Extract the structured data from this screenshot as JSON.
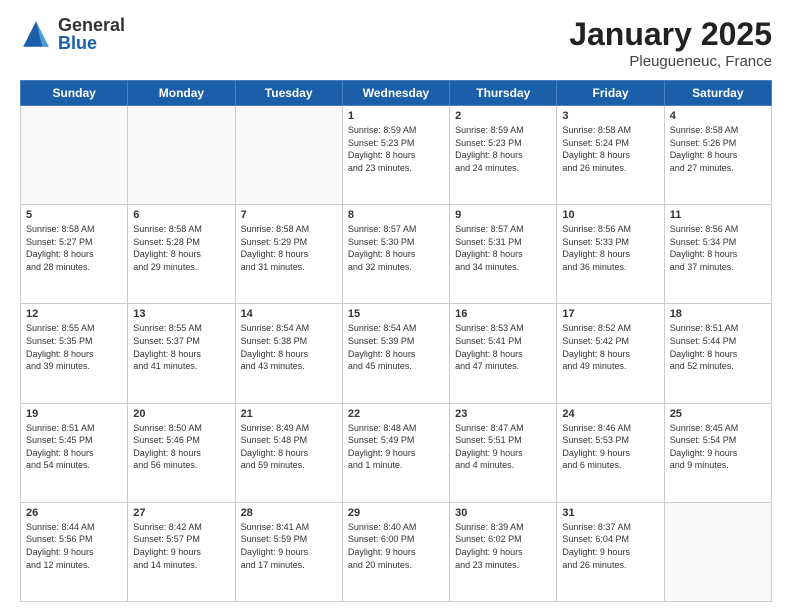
{
  "header": {
    "logo_general": "General",
    "logo_blue": "Blue",
    "title": "January 2025",
    "subtitle": "Pleugueneuc, France"
  },
  "weekdays": [
    "Sunday",
    "Monday",
    "Tuesday",
    "Wednesday",
    "Thursday",
    "Friday",
    "Saturday"
  ],
  "weeks": [
    [
      {
        "day": "",
        "info": ""
      },
      {
        "day": "",
        "info": ""
      },
      {
        "day": "",
        "info": ""
      },
      {
        "day": "1",
        "info": "Sunrise: 8:59 AM\nSunset: 5:23 PM\nDaylight: 8 hours\nand 23 minutes."
      },
      {
        "day": "2",
        "info": "Sunrise: 8:59 AM\nSunset: 5:23 PM\nDaylight: 8 hours\nand 24 minutes."
      },
      {
        "day": "3",
        "info": "Sunrise: 8:58 AM\nSunset: 5:24 PM\nDaylight: 8 hours\nand 26 minutes."
      },
      {
        "day": "4",
        "info": "Sunrise: 8:58 AM\nSunset: 5:26 PM\nDaylight: 8 hours\nand 27 minutes."
      }
    ],
    [
      {
        "day": "5",
        "info": "Sunrise: 8:58 AM\nSunset: 5:27 PM\nDaylight: 8 hours\nand 28 minutes."
      },
      {
        "day": "6",
        "info": "Sunrise: 8:58 AM\nSunset: 5:28 PM\nDaylight: 8 hours\nand 29 minutes."
      },
      {
        "day": "7",
        "info": "Sunrise: 8:58 AM\nSunset: 5:29 PM\nDaylight: 8 hours\nand 31 minutes."
      },
      {
        "day": "8",
        "info": "Sunrise: 8:57 AM\nSunset: 5:30 PM\nDaylight: 8 hours\nand 32 minutes."
      },
      {
        "day": "9",
        "info": "Sunrise: 8:57 AM\nSunset: 5:31 PM\nDaylight: 8 hours\nand 34 minutes."
      },
      {
        "day": "10",
        "info": "Sunrise: 8:56 AM\nSunset: 5:33 PM\nDaylight: 8 hours\nand 36 minutes."
      },
      {
        "day": "11",
        "info": "Sunrise: 8:56 AM\nSunset: 5:34 PM\nDaylight: 8 hours\nand 37 minutes."
      }
    ],
    [
      {
        "day": "12",
        "info": "Sunrise: 8:55 AM\nSunset: 5:35 PM\nDaylight: 8 hours\nand 39 minutes."
      },
      {
        "day": "13",
        "info": "Sunrise: 8:55 AM\nSunset: 5:37 PM\nDaylight: 8 hours\nand 41 minutes."
      },
      {
        "day": "14",
        "info": "Sunrise: 8:54 AM\nSunset: 5:38 PM\nDaylight: 8 hours\nand 43 minutes."
      },
      {
        "day": "15",
        "info": "Sunrise: 8:54 AM\nSunset: 5:39 PM\nDaylight: 8 hours\nand 45 minutes."
      },
      {
        "day": "16",
        "info": "Sunrise: 8:53 AM\nSunset: 5:41 PM\nDaylight: 8 hours\nand 47 minutes."
      },
      {
        "day": "17",
        "info": "Sunrise: 8:52 AM\nSunset: 5:42 PM\nDaylight: 8 hours\nand 49 minutes."
      },
      {
        "day": "18",
        "info": "Sunrise: 8:51 AM\nSunset: 5:44 PM\nDaylight: 8 hours\nand 52 minutes."
      }
    ],
    [
      {
        "day": "19",
        "info": "Sunrise: 8:51 AM\nSunset: 5:45 PM\nDaylight: 8 hours\nand 54 minutes."
      },
      {
        "day": "20",
        "info": "Sunrise: 8:50 AM\nSunset: 5:46 PM\nDaylight: 8 hours\nand 56 minutes."
      },
      {
        "day": "21",
        "info": "Sunrise: 8:49 AM\nSunset: 5:48 PM\nDaylight: 8 hours\nand 59 minutes."
      },
      {
        "day": "22",
        "info": "Sunrise: 8:48 AM\nSunset: 5:49 PM\nDaylight: 9 hours\nand 1 minute."
      },
      {
        "day": "23",
        "info": "Sunrise: 8:47 AM\nSunset: 5:51 PM\nDaylight: 9 hours\nand 4 minutes."
      },
      {
        "day": "24",
        "info": "Sunrise: 8:46 AM\nSunset: 5:53 PM\nDaylight: 9 hours\nand 6 minutes."
      },
      {
        "day": "25",
        "info": "Sunrise: 8:45 AM\nSunset: 5:54 PM\nDaylight: 9 hours\nand 9 minutes."
      }
    ],
    [
      {
        "day": "26",
        "info": "Sunrise: 8:44 AM\nSunset: 5:56 PM\nDaylight: 9 hours\nand 12 minutes."
      },
      {
        "day": "27",
        "info": "Sunrise: 8:42 AM\nSunset: 5:57 PM\nDaylight: 9 hours\nand 14 minutes."
      },
      {
        "day": "28",
        "info": "Sunrise: 8:41 AM\nSunset: 5:59 PM\nDaylight: 9 hours\nand 17 minutes."
      },
      {
        "day": "29",
        "info": "Sunrise: 8:40 AM\nSunset: 6:00 PM\nDaylight: 9 hours\nand 20 minutes."
      },
      {
        "day": "30",
        "info": "Sunrise: 8:39 AM\nSunset: 6:02 PM\nDaylight: 9 hours\nand 23 minutes."
      },
      {
        "day": "31",
        "info": "Sunrise: 8:37 AM\nSunset: 6:04 PM\nDaylight: 9 hours\nand 26 minutes."
      },
      {
        "day": "",
        "info": ""
      }
    ]
  ]
}
